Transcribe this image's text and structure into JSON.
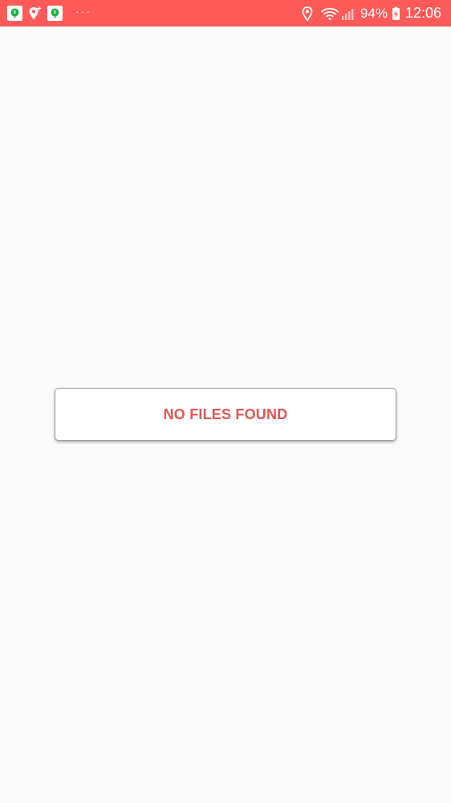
{
  "status_bar": {
    "background_color": "#ff5a57",
    "notification_icons": [
      "app-notification-icon",
      "location-added-icon",
      "app-notification-icon"
    ],
    "more_indicator": "···",
    "system_icons": [
      "location-icon",
      "wifi-icon",
      "signal-icon",
      "battery-charging-icon"
    ],
    "battery_percent": "94%",
    "time": "12:06"
  },
  "main": {
    "background_color": "#fafafa",
    "empty_state": {
      "message": "NO FILES FOUND",
      "text_color": "#e75552"
    }
  }
}
